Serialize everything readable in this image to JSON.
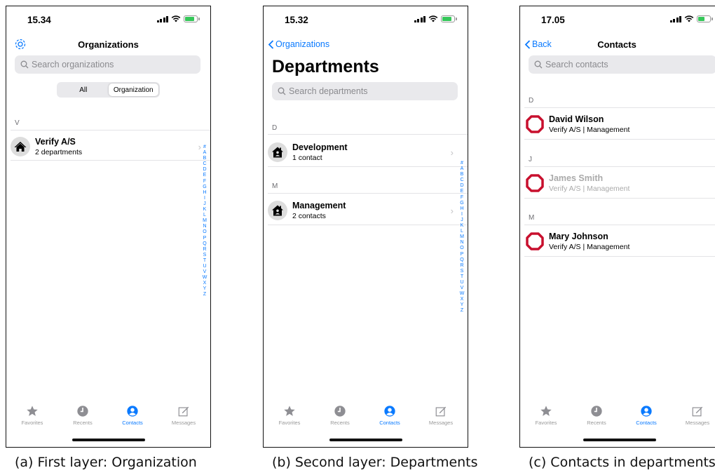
{
  "colors": {
    "accent": "#0a7aff",
    "battery": "#35c759",
    "logo_red": "#c8102e"
  },
  "index_letters": [
    "#",
    "A",
    "B",
    "C",
    "D",
    "E",
    "F",
    "G",
    "H",
    "I",
    "J",
    "K",
    "L",
    "M",
    "N",
    "O",
    "P",
    "Q",
    "R",
    "S",
    "T",
    "U",
    "V",
    "W",
    "X",
    "Y",
    "Z"
  ],
  "screen1": {
    "time": "15.34",
    "nav_title": "Organizations",
    "settings_icon": "gear-icon",
    "search_placeholder": "Search organizations",
    "segments": [
      "All",
      "Organization"
    ],
    "selected_segment": "Organization",
    "section": "V",
    "rows": [
      {
        "title": "Verify A/S",
        "subtitle": "2 departments",
        "icon": "house-icon"
      }
    ]
  },
  "screen2": {
    "time": "15.32",
    "back_label": "Organizations",
    "large_title": "Departments",
    "search_placeholder": "Search departments",
    "sections": [
      {
        "letter": "D",
        "rows": [
          {
            "title": "Development",
            "subtitle": "1 contact",
            "icon": "department-house-icon"
          }
        ]
      },
      {
        "letter": "M",
        "rows": [
          {
            "title": "Management",
            "subtitle": "2 contacts",
            "icon": "department-house-icon"
          }
        ]
      }
    ]
  },
  "screen3": {
    "time": "17.05",
    "back_label": "Back",
    "nav_title": "Contacts",
    "search_placeholder": "Search contacts",
    "sections": [
      {
        "letter": "D",
        "rows": [
          {
            "title": "David Wilson",
            "subtitle": "Verify A/S | Management",
            "dimmed": false
          }
        ]
      },
      {
        "letter": "J",
        "rows": [
          {
            "title": "James Smith",
            "subtitle": "Verify A/S | Management",
            "dimmed": true
          }
        ]
      },
      {
        "letter": "M",
        "rows": [
          {
            "title": "Mary Johnson",
            "subtitle": "Verify A/S | Management",
            "dimmed": false
          }
        ]
      }
    ]
  },
  "tabbar": {
    "tabs": [
      {
        "label": "Favorites",
        "icon": "star-icon"
      },
      {
        "label": "Recents",
        "icon": "clock-icon"
      },
      {
        "label": "Contacts",
        "icon": "person-circle-icon",
        "active": true
      },
      {
        "label": "Messages",
        "icon": "compose-icon"
      }
    ]
  },
  "captions": [
    "(a) First layer: Organization",
    "(b) Second layer: Departments",
    "(c) Contacts in departments"
  ]
}
